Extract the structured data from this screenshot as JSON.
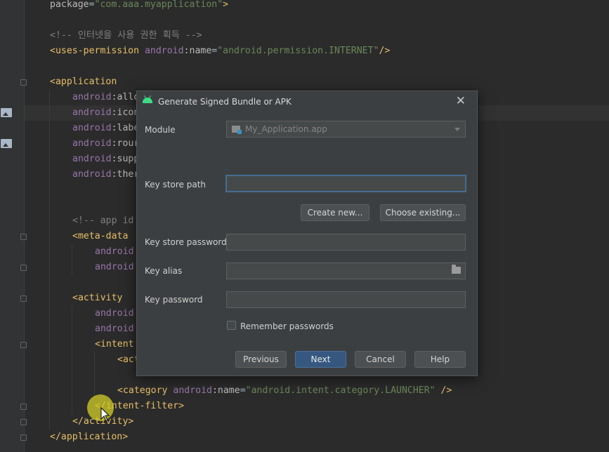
{
  "editor": {
    "lines": [
      {
        "parts": [
          {
            "c": "attr",
            "t": "package"
          },
          {
            "c": "plain",
            "t": "="
          },
          {
            "c": "str",
            "t": "\"com.aaa.myapplication\""
          },
          {
            "c": "tag",
            "t": ">"
          }
        ]
      },
      {
        "parts": []
      },
      {
        "parts": [
          {
            "c": "cmt",
            "t": "<!-- 인터넷을 사용 권한 획득 -->"
          }
        ]
      },
      {
        "parts": [
          {
            "c": "tag",
            "t": "<uses-permission "
          },
          {
            "c": "ns",
            "t": "android"
          },
          {
            "c": "attr",
            "t": ":name"
          },
          {
            "c": "plain",
            "t": "="
          },
          {
            "c": "str",
            "t": "\"android.permission.INTERNET\""
          },
          {
            "c": "tag",
            "t": "/>"
          }
        ]
      },
      {
        "parts": []
      },
      {
        "parts": [
          {
            "c": "tag",
            "t": "<application"
          }
        ]
      },
      {
        "parts": [
          {
            "c": "ns",
            "t": "android"
          },
          {
            "c": "attr",
            "t": ":allo"
          }
        ]
      },
      {
        "parts": [
          {
            "c": "ns",
            "t": "android"
          },
          {
            "c": "attr",
            "t": ":icon"
          }
        ]
      },
      {
        "parts": [
          {
            "c": "ns",
            "t": "android"
          },
          {
            "c": "attr",
            "t": ":labe"
          }
        ]
      },
      {
        "parts": [
          {
            "c": "ns",
            "t": "android"
          },
          {
            "c": "attr",
            "t": ":rour"
          }
        ]
      },
      {
        "parts": [
          {
            "c": "ns",
            "t": "android"
          },
          {
            "c": "attr",
            "t": ":supp"
          }
        ]
      },
      {
        "parts": [
          {
            "c": "ns",
            "t": "android"
          },
          {
            "c": "attr",
            "t": ":ther"
          }
        ]
      },
      {
        "parts": []
      },
      {
        "parts": []
      },
      {
        "parts": [
          {
            "c": "cmt",
            "t": "<!-- app id"
          }
        ]
      },
      {
        "parts": [
          {
            "c": "tag",
            "t": "<meta-data"
          }
        ]
      },
      {
        "parts": [
          {
            "c": "ns",
            "t": "android"
          }
        ]
      },
      {
        "parts": [
          {
            "c": "ns",
            "t": "android"
          }
        ]
      },
      {
        "parts": []
      },
      {
        "parts": [
          {
            "c": "tag",
            "t": "<activity"
          }
        ]
      },
      {
        "parts": [
          {
            "c": "ns",
            "t": "android"
          }
        ]
      },
      {
        "parts": [
          {
            "c": "ns",
            "t": "android"
          }
        ]
      },
      {
        "parts": [
          {
            "c": "tag",
            "t": "<intent"
          }
        ]
      },
      {
        "parts": [
          {
            "c": "tag",
            "t": "<act"
          }
        ]
      },
      {
        "parts": []
      },
      {
        "parts": [
          {
            "c": "tag",
            "t": "<category "
          },
          {
            "c": "ns",
            "t": "android"
          },
          {
            "c": "attr",
            "t": ":name"
          },
          {
            "c": "plain",
            "t": "="
          },
          {
            "c": "str",
            "t": "\"android.intent.category.LAUNCHER\""
          },
          {
            "c": "tag",
            "t": " />"
          }
        ]
      },
      {
        "parts": [
          {
            "c": "tag",
            "t": "</intent-filter>"
          }
        ]
      },
      {
        "parts": [
          {
            "c": "tag",
            "t": "</activity>"
          }
        ]
      },
      {
        "parts": [
          {
            "c": "tag",
            "t": "</application>"
          }
        ]
      }
    ]
  },
  "dialog": {
    "title": "Generate Signed Bundle or APK",
    "close_icon": "close-icon",
    "module_label": "Module",
    "module_value": "My_Application.app",
    "keystore_path_label": "Key store path",
    "keystore_path_value": "",
    "create_new_label": "Create new...",
    "choose_existing_label": "Choose existing...",
    "keystore_password_label": "Key store password",
    "key_alias_label": "Key alias",
    "key_password_label": "Key password",
    "remember_label": "Remember passwords",
    "previous_label": "Previous",
    "next_label": "Next",
    "cancel_label": "Cancel",
    "help_label": "Help"
  }
}
